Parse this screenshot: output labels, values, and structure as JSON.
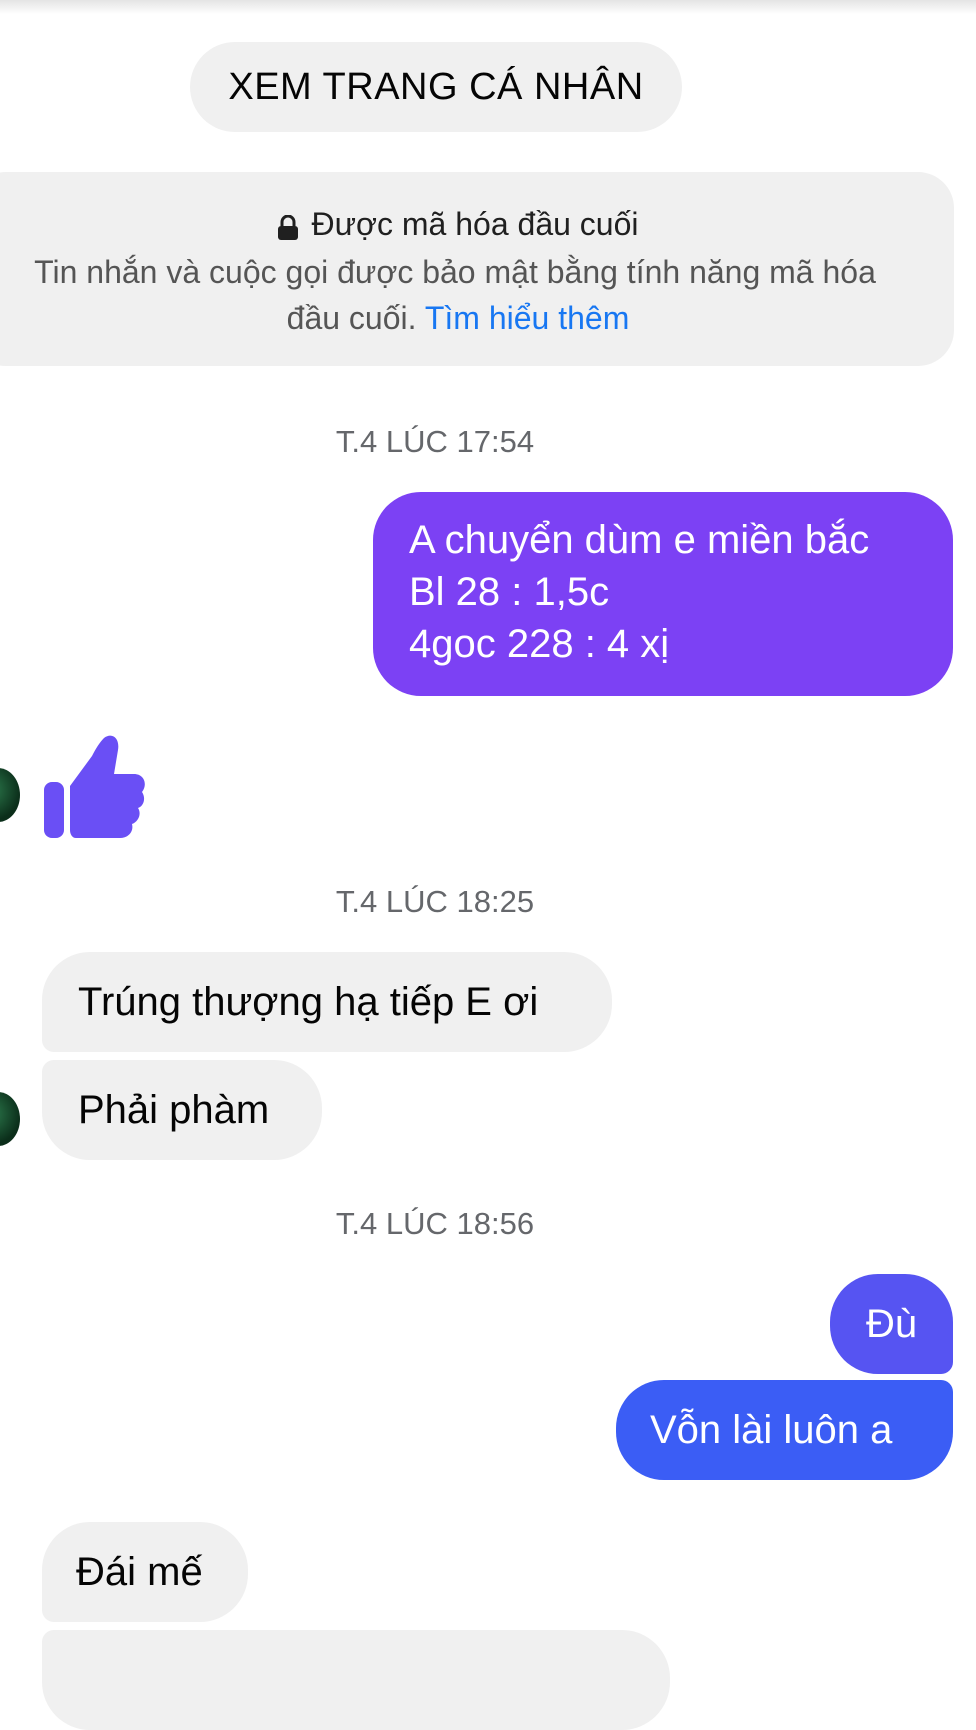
{
  "profile_button": {
    "label": "XEM TRANG CÁ NHÂN"
  },
  "encryption": {
    "title": "Được mã hóa đầu cuối",
    "description_line1": "Tin nhắn và cuộc gọi được bảo mật bằng tính năng mã hóa",
    "description_line2": "đầu cuối.",
    "learn_more": "Tìm hiểu thêm"
  },
  "colors": {
    "outgoing_purple": "#7c41f4",
    "outgoing_indigo": "#5654f2",
    "outgoing_blue": "#3b5df5",
    "incoming_gray": "#f0f0f0",
    "link_blue": "#1877f2",
    "like_icon": "#6a4ff5"
  },
  "conversation": {
    "timestamp_1": "T.4 LÚC 17:54",
    "outgoing_1": {
      "lines": [
        "A chuyển dùm e miền bắc",
        "Bl 28 : 1,5c",
        "4goc 228 : 4 xị"
      ]
    },
    "reaction": {
      "icon": "thumbs-up-icon"
    },
    "timestamp_2": "T.4 LÚC 18:25",
    "incoming_1": "Trúng thượng hạ tiếp E ơi",
    "incoming_2": "Phải phàm",
    "timestamp_3": "T.4 LÚC 18:56",
    "outgoing_2": "Đù",
    "outgoing_3": "Vỗn lài luôn a",
    "incoming_3": "Đái mế"
  }
}
